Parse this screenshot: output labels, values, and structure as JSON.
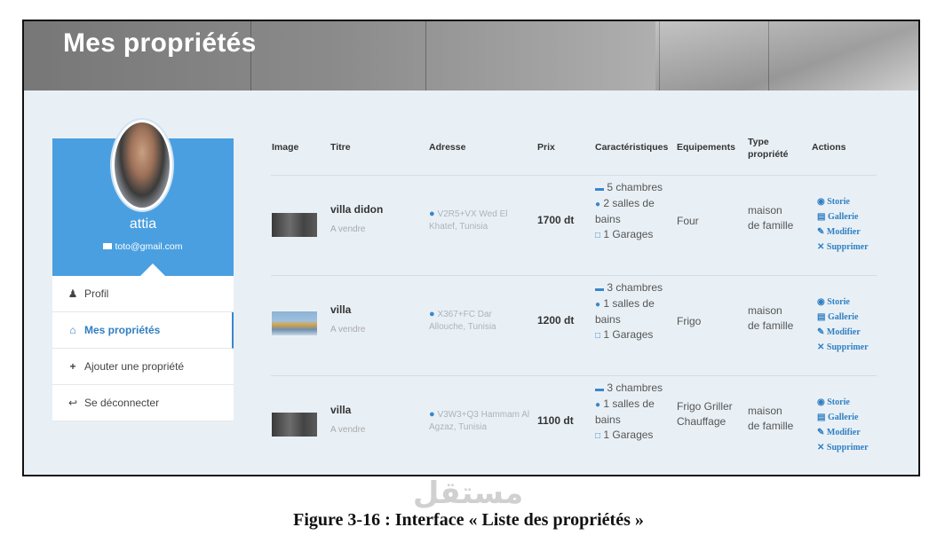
{
  "header": {
    "title": "Mes propriétés"
  },
  "profile": {
    "name": "attia",
    "email": "toto@gmail.com"
  },
  "menu": [
    {
      "label": "Profil",
      "icon": "user-icon"
    },
    {
      "label": "Mes propriétés",
      "icon": "home-icon"
    },
    {
      "label": "Ajouter une propriété",
      "icon": "plus-icon"
    },
    {
      "label": "Se déconnecter",
      "icon": "logout-icon"
    }
  ],
  "table": {
    "headers": [
      "Image",
      "Titre",
      "Adresse",
      "Prix",
      "Caractéristiques",
      "Equipements",
      "Type propriété",
      "Actions"
    ],
    "rows": [
      {
        "titre": "villa didon",
        "statut": "A vendre",
        "adresse": "V2R5+VX Wed El Khatef, Tunisia",
        "prix": "1700 dt",
        "chambres": "5 chambres",
        "bains": "2 salles de bains",
        "garages": "1 Garages",
        "equipements": "Four",
        "type": "maison de famille"
      },
      {
        "titre": "villa",
        "statut": "A vendre",
        "adresse": "X367+FC Dar Allouche, Tunisia",
        "prix": "1200 dt",
        "chambres": "3 chambres",
        "bains": "1 salles de bains",
        "garages": "1 Garages",
        "equipements": "Frigo",
        "type": "maison de famille"
      },
      {
        "titre": "villa",
        "statut": "A vendre",
        "adresse": "V3W3+Q3 Hammam Al Agzaz, Tunisia",
        "prix": "1100 dt",
        "chambres": "3 chambres",
        "bains": "1 salles de bains",
        "garages": "1 Garages",
        "equipements": "Frigo Griller Chauffage",
        "type": "maison de famille"
      }
    ],
    "actions": [
      "Storie",
      "Gallerie",
      "Modifier",
      "Supprimer"
    ]
  },
  "watermark": "مستقل",
  "caption": "Figure 3-16 : Interface « Liste des propriétés »",
  "colors": {
    "accent": "#4a9fe0",
    "link": "#2f7fc3"
  }
}
